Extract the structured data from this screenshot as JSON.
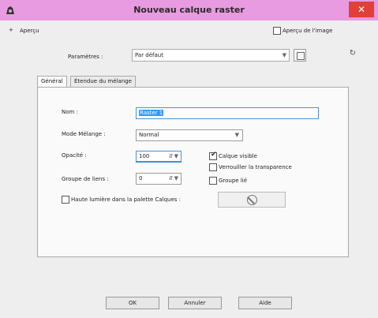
{
  "window": {
    "title": "Nouveau calque raster",
    "close_glyph": "✕"
  },
  "preview": {
    "expander": "+",
    "label": "Aperçu",
    "image_preview_label": "Aperçu de l'image",
    "image_preview_checked": false
  },
  "presets": {
    "label": "Paramètres :",
    "value": "Par défaut",
    "save_icon": "save-preset-icon",
    "reset_icon": "reset-preset-icon"
  },
  "tabs": [
    {
      "label": "Général",
      "active": true
    },
    {
      "label": "Étendue du mélange",
      "active": false
    }
  ],
  "form": {
    "name_label": "Nom :",
    "name_value": "Raster 1",
    "blend_label": "Mode Mélange :",
    "blend_value": "Normal",
    "opacity_label": "Opacité :",
    "opacity_value": "100",
    "group_label": "Groupe de liens :",
    "group_value": "0",
    "visible_label": "Calque visible",
    "visible_checked": true,
    "lock_transparency_label": "Verrouiller la transparence",
    "lock_transparency_checked": false,
    "linked_group_label": "Groupe lié",
    "linked_group_checked": false,
    "highlight_label": "Haute lumière dans la palette Calques :",
    "highlight_checked": false
  },
  "footer": {
    "ok_label": "OK",
    "cancel_label": "Annuler",
    "help_label": "Aide"
  },
  "colors": {
    "titlebar": "#e89be0",
    "close": "#e0403a",
    "selection": "#3399ff",
    "focus": "#4a90d9"
  }
}
